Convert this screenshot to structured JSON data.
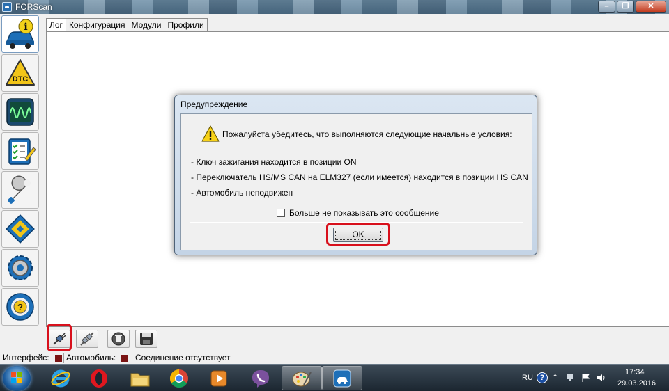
{
  "window": {
    "title": "FORScan",
    "controls": {
      "minimize": "–",
      "maximize": "❐",
      "close": "✕"
    }
  },
  "sidebar": {
    "items": [
      {
        "id": "info",
        "icon": "car-info-icon",
        "active": true
      },
      {
        "id": "dtc",
        "icon": "dtc-warning-icon",
        "label": "DTC"
      },
      {
        "id": "oscilloscope",
        "icon": "oscilloscope-icon"
      },
      {
        "id": "tests",
        "icon": "checklist-icon"
      },
      {
        "id": "service",
        "icon": "wrench-icon"
      },
      {
        "id": "config",
        "icon": "chip-icon"
      },
      {
        "id": "settings",
        "icon": "gear-icon"
      },
      {
        "id": "help",
        "icon": "help-wheel-icon"
      }
    ]
  },
  "tabs": [
    {
      "label": "Лог",
      "active": true
    },
    {
      "label": "Конфигурация",
      "active": false
    },
    {
      "label": "Модули",
      "active": false
    },
    {
      "label": "Профили",
      "active": false
    }
  ],
  "dialog": {
    "title": "Предупреждение",
    "message": "Пожалуйста убедитесь, что выполняются следующие начальные условия:",
    "conditions": [
      "- Ключ зажигания находится в позиции ON",
      "- Переключатель HS/MS CAN на ELM327 (если имеется) находится в позиции HS CAN",
      "- Автомобиль неподвижен"
    ],
    "checkbox_label": "Больше не показывать это сообщение",
    "checkbox_checked": false,
    "ok_label": "OK"
  },
  "toolbar": {
    "buttons": [
      {
        "id": "connect",
        "icon": "connect-plug-icon"
      },
      {
        "id": "disconnect",
        "icon": "disconnect-plug-icon"
      },
      {
        "id": "clear",
        "icon": "clear-icon"
      },
      {
        "id": "save",
        "icon": "save-icon"
      }
    ]
  },
  "statusbar": {
    "interface_label": "Интерфейс:",
    "vehicle_label": "Автомобиль:",
    "connection_text": "Соединение отсутствует",
    "led_color": "#7a1414"
  },
  "taskbar": {
    "apps": [
      {
        "name": "internet-explorer-icon",
        "running": false
      },
      {
        "name": "opera-icon",
        "running": false
      },
      {
        "name": "file-explorer-icon",
        "running": false
      },
      {
        "name": "chrome-icon",
        "running": false
      },
      {
        "name": "media-player-icon",
        "running": false
      },
      {
        "name": "viber-icon",
        "running": false
      },
      {
        "name": "paint-icon",
        "running": true
      },
      {
        "name": "forscan-icon",
        "running": true
      }
    ],
    "tray": {
      "language": "RU",
      "time": "17:34",
      "date": "29.03.2016"
    }
  },
  "colors": {
    "highlight": "#d8101c",
    "accent": "#1d6fb8"
  }
}
